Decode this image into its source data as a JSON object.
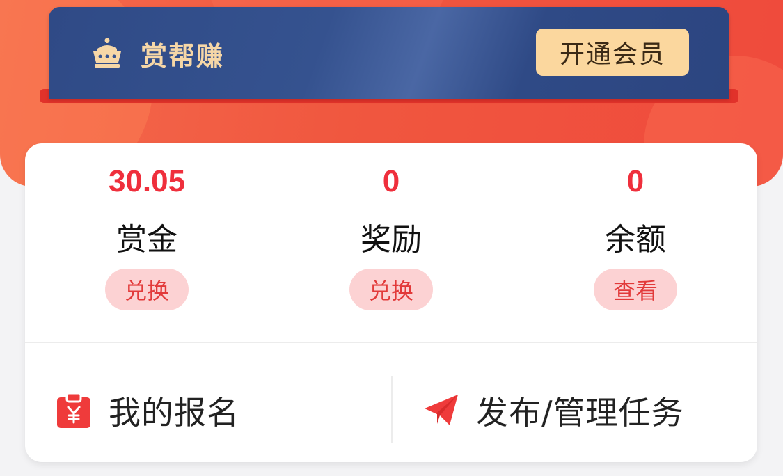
{
  "vip": {
    "title": "赏帮赚",
    "button_label": "开通会员",
    "colors": {
      "card": "#2f4a86",
      "title": "#f6d7a7",
      "button": "#fbd79e"
    },
    "icon": "crown-icon"
  },
  "stats": [
    {
      "value": "30.05",
      "label": "赏金",
      "action_label": "兑换"
    },
    {
      "value": "0",
      "label": "奖励",
      "action_label": "兑换"
    },
    {
      "value": "0",
      "label": "余额",
      "action_label": "查看"
    }
  ],
  "actions": {
    "signup": {
      "label": "我的报名",
      "icon": "yen-clipboard-icon"
    },
    "publish": {
      "label": "发布/管理任务",
      "icon": "paper-plane-icon"
    }
  },
  "colors": {
    "accent": "#ef2f3c",
    "hero": "#f0573f",
    "pill": "#fcd2d3"
  }
}
